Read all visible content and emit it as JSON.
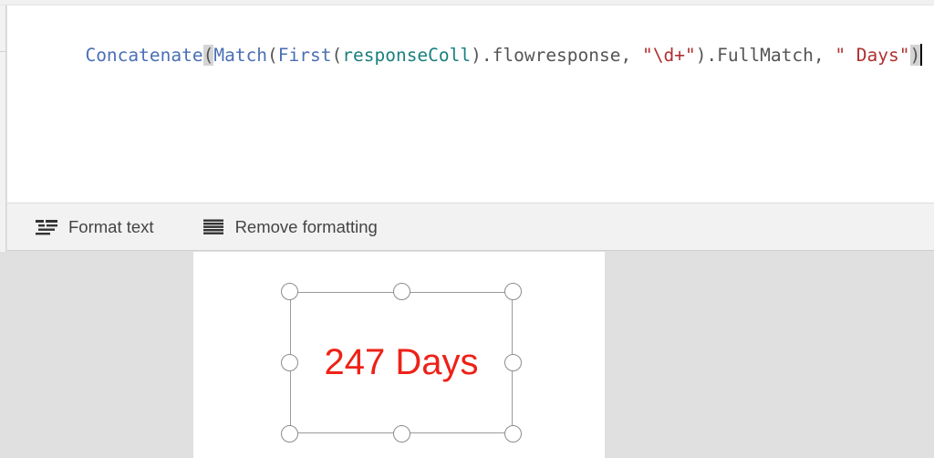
{
  "formula_bar": {
    "tokens": [
      {
        "text": "Concatenate",
        "kind": "fn"
      },
      {
        "text": "(",
        "kind": "match"
      },
      {
        "text": "Match",
        "kind": "fn"
      },
      {
        "text": "(",
        "kind": "punct"
      },
      {
        "text": "First",
        "kind": "fn"
      },
      {
        "text": "(",
        "kind": "punct"
      },
      {
        "text": "responseColl",
        "kind": "ident"
      },
      {
        "text": ").flowresponse, ",
        "kind": "plain"
      },
      {
        "text": "\"\\d+\"",
        "kind": "str"
      },
      {
        "text": ").FullMatch, ",
        "kind": "plain"
      },
      {
        "text": "\" Days\"",
        "kind": "str"
      },
      {
        "text": ")",
        "kind": "match"
      }
    ],
    "full_text": "Concatenate(Match(First(responseColl).flowresponse, \"\\d+\").FullMatch, \" Days\")",
    "colors": {
      "function": "#4a6fb5",
      "identifier": "#1a7f7f",
      "string": "#b03030",
      "plain": "#555555",
      "bracket_match_highlight": "#d4d4d4",
      "caret": "#000000"
    }
  },
  "toolbar": {
    "buttons": [
      {
        "label": "Format text",
        "icon": "format-text-icon"
      },
      {
        "label": "Remove formatting",
        "icon": "remove-formatting-icon"
      }
    ]
  },
  "canvas": {
    "selected_control": {
      "text": "247 Days",
      "text_color": "#ee2117",
      "font_size_px": 40,
      "handle_count": 8,
      "handles": [
        "top-left",
        "top-center",
        "top-right",
        "middle-left",
        "middle-right",
        "bottom-left",
        "bottom-center",
        "bottom-right"
      ]
    },
    "page_background": "#ffffff",
    "workspace_background": "#e0e0e0"
  }
}
